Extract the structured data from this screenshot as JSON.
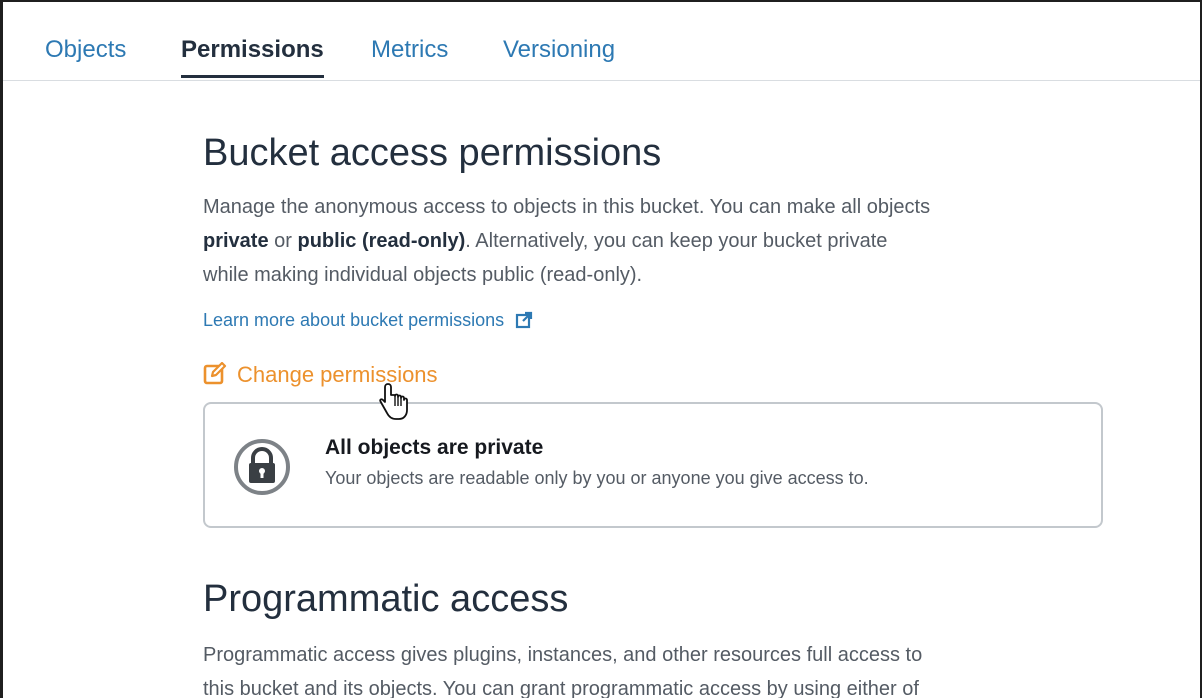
{
  "tabs": [
    {
      "label": "Objects",
      "active": false
    },
    {
      "label": "Permissions",
      "active": true
    },
    {
      "label": "Metrics",
      "active": false
    },
    {
      "label": "Versioning",
      "active": false
    }
  ],
  "bucket_access": {
    "heading": "Bucket access permissions",
    "description_line1": "Manage the anonymous access to objects in this bucket. You can make all objects",
    "bold_private": "private",
    "or_text": " or ",
    "bold_public": "public (read-only)",
    "description_line2_rest": ". Alternatively, you can keep your bucket private",
    "description_line3": "while making individual objects public (read-only).",
    "learn_more_link": "Learn more about bucket permissions",
    "change_permissions_label": "Change permissions",
    "status": {
      "title": "All objects are private",
      "description": "Your objects are readable only by you or anyone you give access to.",
      "icon": "lock-icon"
    }
  },
  "programmatic_access": {
    "heading": "Programmatic access",
    "description_line1": "Programmatic access gives plugins, instances, and other resources full access to",
    "description_line2": "this bucket and its objects. You can grant programmatic access by using either of"
  },
  "colors": {
    "link": "#2d79b3",
    "accent_orange": "#ec912d",
    "heading": "#232f3e",
    "body_text": "#545b64",
    "border": "#c3c8cd"
  }
}
